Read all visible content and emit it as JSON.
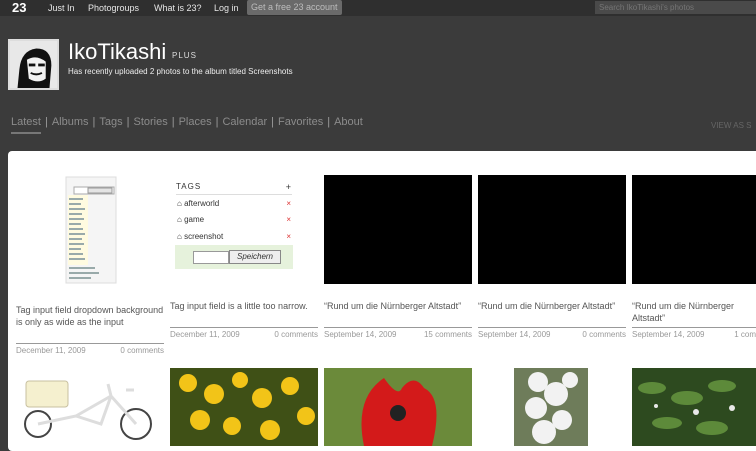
{
  "topbar": {
    "logo": "23",
    "links": [
      "Just In",
      "Photogroups",
      "What is 23?",
      "Log in"
    ],
    "cta": "Get a free 23 account",
    "search_placeholder": "Search IkoTikashi's photos"
  },
  "profile": {
    "name": "IkoTikashi",
    "plan": "PLUS",
    "status": "Has recently uploaded 2 photos to the album titled Screenshots"
  },
  "tabs": [
    "Latest",
    "Albums",
    "Tags",
    "Stories",
    "Places",
    "Calendar",
    "Favorites",
    "About"
  ],
  "view_as": "VIEW AS S",
  "photos": [
    {
      "caption": "Tag input field dropdown background is only as wide as the input",
      "date": "December 11, 2009",
      "comments": "0 comments"
    },
    {
      "caption": "Tag input field is a little too narrow.",
      "date": "December 11, 2009",
      "comments": "0 comments"
    },
    {
      "caption": "“Rund um die Nürnberger Altstadt”",
      "date": "September 14, 2009",
      "comments": "15 comments"
    },
    {
      "caption": "“Rund um die Nürnberger Altstadt”",
      "date": "September 14, 2009",
      "comments": "0 comments"
    },
    {
      "caption": "“Rund um die Nürnberger Altstadt”",
      "date": "September 14, 2009",
      "comments": "1 com"
    }
  ],
  "tags_widget": {
    "title": "TAGS",
    "tags": [
      "afterworld",
      "game",
      "screenshot"
    ],
    "save": "Speichern"
  }
}
